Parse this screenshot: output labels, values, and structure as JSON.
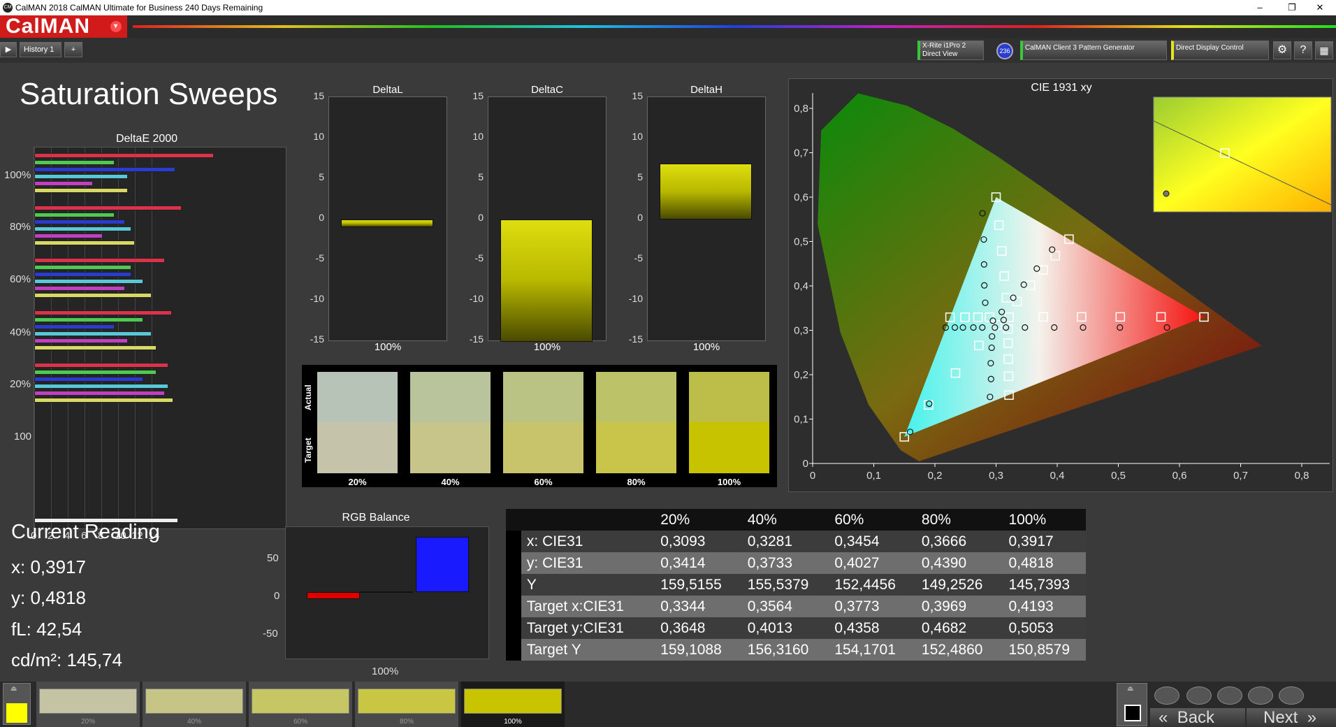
{
  "window": {
    "title": "CalMAN 2018 CalMAN Ultimate for Business 240 Days Remaining",
    "icon": "CM",
    "min": "–",
    "max": "❐",
    "close": "✕"
  },
  "logo": {
    "text": "CalMAN",
    "dropdown": "▾"
  },
  "tabs": [
    {
      "label": "History 1"
    },
    {
      "label": "+"
    }
  ],
  "devices": [
    {
      "label": "X-Rite i1Pro 2\nDirect View",
      "color": "#38c838"
    },
    {
      "label": "236",
      "color": "#2a3ccf"
    },
    {
      "label": "CalMAN Client 3 Pattern Generator",
      "color": "#38c838"
    },
    {
      "label": "Direct Display Control",
      "color": "#e6e61e"
    }
  ],
  "icons": {
    "settings": "⚙",
    "help": "?",
    "grid": "▦"
  },
  "page_title": "Saturation Sweeps",
  "deltae": {
    "title": "DeltaE 2000",
    "ylabels": [
      "100%",
      "80%",
      "60%",
      "40%",
      "20%",
      "100"
    ],
    "xticks": [
      "0",
      "2",
      "4",
      "6",
      "8",
      "10",
      "12",
      "14"
    ]
  },
  "delta_plots": [
    {
      "title": "DeltaL",
      "yticks": [
        "15",
        "10",
        "5",
        "0",
        "-5",
        "-10",
        "-15"
      ],
      "xlabel": "100%",
      "value": -0.9
    },
    {
      "title": "DeltaC",
      "yticks": [
        "15",
        "10",
        "5",
        "0",
        "-5",
        "-10",
        "-15"
      ],
      "xlabel": "100%",
      "value": -15
    },
    {
      "title": "DeltaH",
      "yticks": [
        "15",
        "10",
        "5",
        "0",
        "-5",
        "-10",
        "-15"
      ],
      "xlabel": "100%",
      "value": 6.9
    }
  ],
  "swatches": {
    "actual_label": "Actual",
    "target_label": "Target",
    "items": [
      {
        "label": "20%",
        "actual": "#b7c3b6",
        "target": "#c5c3a9"
      },
      {
        "label": "40%",
        "actual": "#b9c49d",
        "target": "#c7c58a"
      },
      {
        "label": "60%",
        "actual": "#bbc384",
        "target": "#c8c46b"
      },
      {
        "label": "80%",
        "actual": "#bcc268",
        "target": "#c9c44a"
      },
      {
        "label": "100%",
        "actual": "#bdbd4a",
        "target": "#c8c300"
      }
    ]
  },
  "cie": {
    "title": "CIE 1931 xy",
    "xticks": [
      "0",
      "0,1",
      "0,2",
      "0,3",
      "0,4",
      "0,5",
      "0,6",
      "0,7",
      "0,8"
    ],
    "yticks": [
      "0,8",
      "0,7",
      "0,6",
      "0,5",
      "0,4",
      "0,3",
      "0,2",
      "0,1",
      "0"
    ]
  },
  "current": {
    "title": "Current Reading",
    "x": "x: 0,3917",
    "y": "y: 0,4818",
    "fl": "fL: 42,54",
    "cd": "cd/m²: 145,74"
  },
  "rgb": {
    "title": "RGB Balance",
    "yticks": [
      "50",
      "0",
      "-50"
    ],
    "xlabel": "100%",
    "red": -11,
    "green": 0,
    "blue": 85
  },
  "table": {
    "headers": [
      "",
      "20%",
      "40%",
      "60%",
      "80%",
      "100%"
    ],
    "rows": [
      [
        "x: CIE31",
        "0,3093",
        "0,3281",
        "0,3454",
        "0,3666",
        "0,3917"
      ],
      [
        "y: CIE31",
        "0,3414",
        "0,3733",
        "0,4027",
        "0,4390",
        "0,4818"
      ],
      [
        "Y",
        "159,5155",
        "155,5379",
        "152,4456",
        "149,2526",
        "145,7393"
      ],
      [
        "Target x:CIE31",
        "0,3344",
        "0,3564",
        "0,3773",
        "0,3969",
        "0,4193"
      ],
      [
        "Target y:CIE31",
        "0,3648",
        "0,4013",
        "0,4358",
        "0,4682",
        "0,5053"
      ],
      [
        "Target Y",
        "159,1088",
        "156,3160",
        "154,1701",
        "152,4860",
        "150,8579"
      ]
    ]
  },
  "bottom": {
    "color": "#ffff00",
    "steps": [
      {
        "label": "20%",
        "color": "#c4c4a4"
      },
      {
        "label": "40%",
        "color": "#c6c585"
      },
      {
        "label": "60%",
        "color": "#c7c665"
      },
      {
        "label": "80%",
        "color": "#c8c643"
      },
      {
        "label": "100%",
        "color": "#c8c400"
      }
    ],
    "back": "Back",
    "next": "Next"
  }
}
